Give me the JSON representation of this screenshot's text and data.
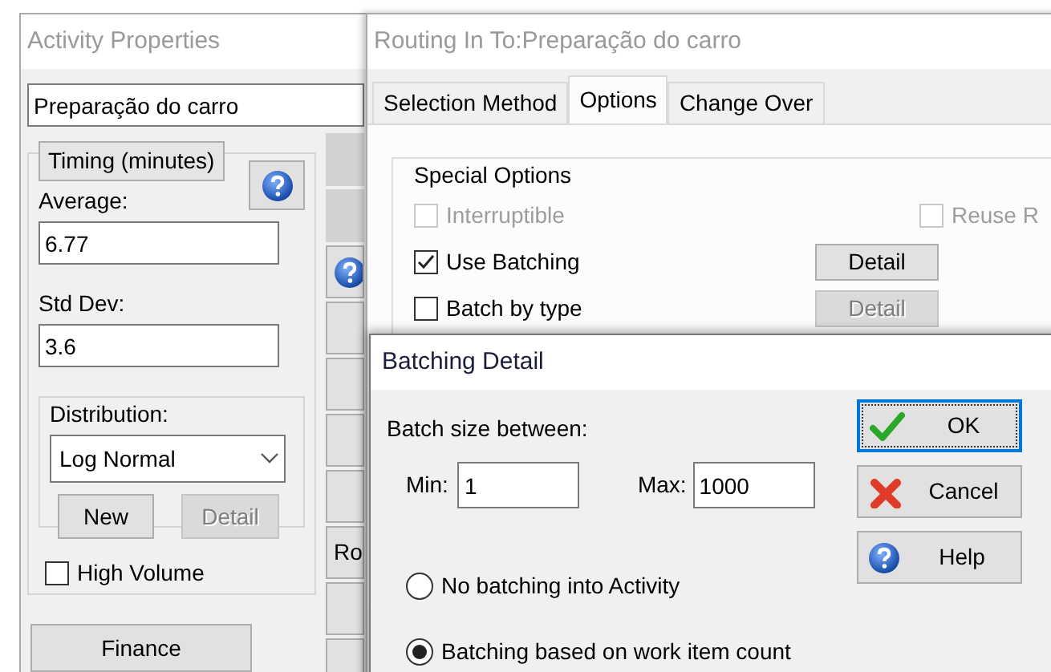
{
  "activity_window": {
    "title": "Activity Properties",
    "name": "Preparação do carro",
    "timing": {
      "label": "Timing (minutes)",
      "average_label": "Average:",
      "average": "6.77",
      "std_dev_label": "Std Dev:",
      "std_dev": "3.6",
      "distribution_label": "Distribution:",
      "distribution": "Log Normal",
      "buttons": [
        {
          "label": "New",
          "disabled": false
        },
        {
          "label": "Detail",
          "disabled": true
        }
      ]
    },
    "high_volume": {
      "label": "High Volume",
      "checked": false
    },
    "finance_button": "Finance",
    "side_buttons": [
      {
        "kind": "shaded"
      },
      {
        "kind": "shaded"
      },
      {
        "kind": "help"
      },
      {
        "kind": "blank"
      },
      {
        "kind": "blank"
      },
      {
        "kind": "blank"
      },
      {
        "kind": "blank"
      },
      {
        "kind": "text",
        "label": "Ro"
      },
      {
        "kind": "blank"
      },
      {
        "kind": "blank"
      }
    ]
  },
  "routing_window": {
    "title": "Routing In To:Preparação do carro",
    "tabs": [
      {
        "label": "Selection Method",
        "selected": false
      },
      {
        "label": "Options",
        "selected": true
      },
      {
        "label": "Change Over",
        "selected": false
      }
    ],
    "special_options": {
      "label": "Special Options",
      "rows": [
        [
          {
            "kind": "checkbox",
            "label": "Interruptible",
            "checked": false,
            "disabled": true
          },
          {
            "kind": "checkbox",
            "label": "Reuse R",
            "checked": false,
            "disabled": true
          }
        ],
        [
          {
            "kind": "checkbox",
            "label": "Use Batching",
            "checked": true,
            "disabled": false
          },
          {
            "kind": "button",
            "label": "Detail",
            "disabled": false
          }
        ],
        [
          {
            "kind": "checkbox",
            "label": "Batch by type",
            "checked": false,
            "disabled": false
          },
          {
            "kind": "button",
            "label": "Detail",
            "disabled": true
          }
        ]
      ]
    }
  },
  "batching_dialog": {
    "title": "Batching Detail",
    "batch_size_label": "Batch size between:",
    "min_label": "Min:",
    "min": "1",
    "max_label": "Max:",
    "max": "1000",
    "radios": [
      {
        "label": "No batching into Activity",
        "selected": false
      },
      {
        "label": "Batching based on work item count",
        "selected": true
      }
    ],
    "buttons": [
      {
        "kind": "ok",
        "label": "OK",
        "focused": true
      },
      {
        "kind": "cancel",
        "label": "Cancel",
        "focused": false
      },
      {
        "kind": "help",
        "label": "Help",
        "focused": false
      }
    ]
  }
}
